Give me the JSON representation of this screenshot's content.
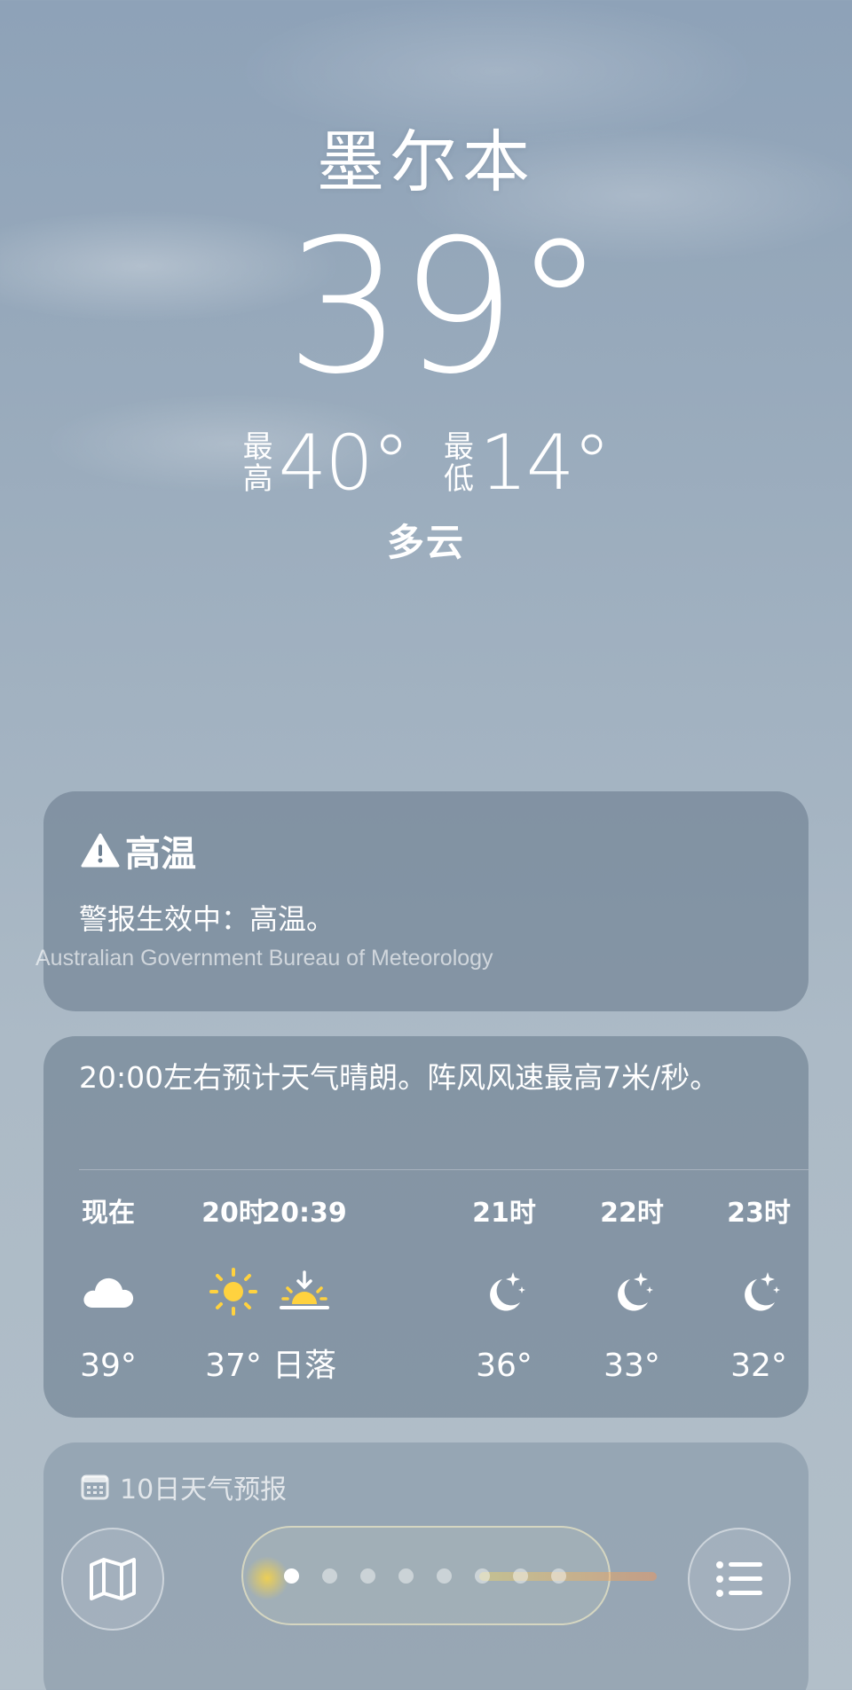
{
  "location": {
    "city": "墨尔本",
    "current_temp": "39°",
    "high_label_top": "最",
    "high_label_bottom": "高",
    "high": "40°",
    "low_label_top": "最",
    "low_label_bottom": "低",
    "low": "14°",
    "condition": "多云"
  },
  "alert": {
    "icon": "warning-triangle-icon",
    "title": "高温",
    "body": "警报生效中：高温。",
    "source": "Australian Government Bureau of Meteorology"
  },
  "hourly": {
    "summary": "20:00左右预计天气晴朗。阵风风速最高7米/秒。",
    "hours": [
      {
        "label": "现在",
        "icon": "cloud-icon",
        "temp": "39°"
      },
      {
        "label": "20时",
        "icon": "sun-icon",
        "temp": "37°"
      },
      {
        "label": "20:39",
        "icon": "sunset-icon",
        "temp": "日落"
      },
      {
        "label": "21时",
        "icon": "moon-stars-icon",
        "temp": "36°"
      },
      {
        "label": "22时",
        "icon": "moon-stars-icon",
        "temp": "33°"
      },
      {
        "label": "23时",
        "icon": "moon-stars-icon",
        "temp": "32°"
      }
    ]
  },
  "forecast": {
    "icon": "calendar-icon",
    "title": "10日天气预报"
  },
  "bottom_bar": {
    "map_icon": "map-icon",
    "list_icon": "list-icon",
    "page_count": 8,
    "active_page": 1
  },
  "colors": {
    "sun": "#FFD23F",
    "card": "#6C7E90"
  }
}
